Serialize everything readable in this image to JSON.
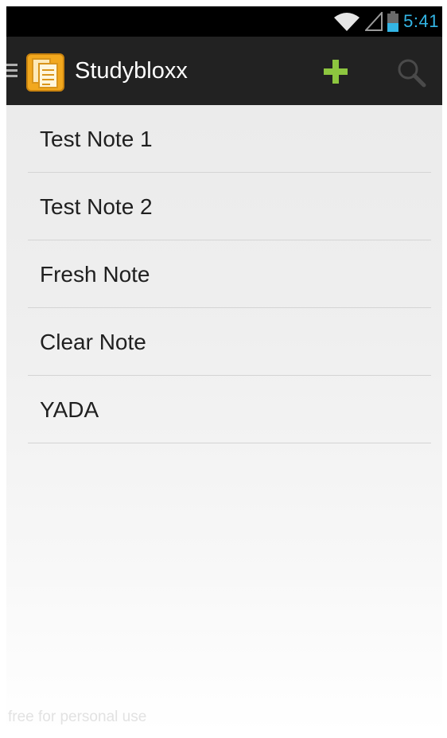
{
  "status_bar": {
    "time": "5:41",
    "icons": [
      "wifi-icon",
      "signal-icon",
      "battery-icon"
    ],
    "time_color": "#33b5e5"
  },
  "action_bar": {
    "title": "Studybloxx",
    "drawer_icon": "menu-icon",
    "logo_icon": "notes-logo-icon",
    "actions": [
      {
        "name": "add",
        "icon": "plus-icon",
        "color": "#8dc63f"
      },
      {
        "name": "search",
        "icon": "search-icon",
        "color": "#555555"
      }
    ],
    "background": "#222222"
  },
  "notes": [
    {
      "title": "Test Note 1"
    },
    {
      "title": "Test Note 2"
    },
    {
      "title": "Fresh Note"
    },
    {
      "title": "Clear Note"
    },
    {
      "title": "YADA"
    }
  ],
  "watermark": "free for personal use"
}
